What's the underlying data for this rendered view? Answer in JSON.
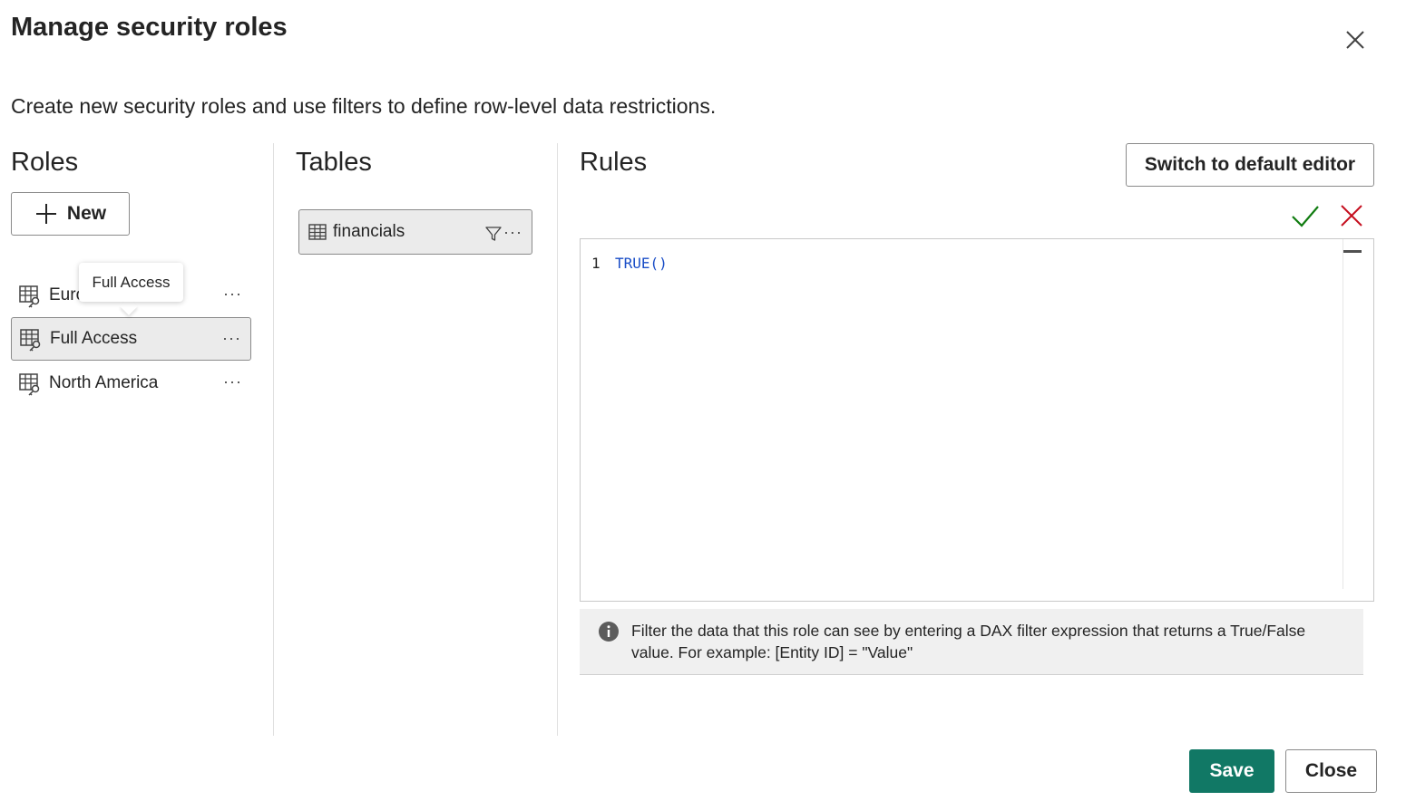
{
  "dialog": {
    "title": "Manage security roles",
    "subtitle": "Create new security roles and use filters to define row-level data restrictions.",
    "close_icon": "close-icon"
  },
  "roles": {
    "heading": "Roles",
    "new_button": "New",
    "tooltip": "Full Access",
    "items": [
      {
        "label": "Euro",
        "selected": false,
        "icon": "role-table-key-icon"
      },
      {
        "label": "Full Access",
        "selected": true,
        "icon": "role-table-key-icon"
      },
      {
        "label": "North America",
        "selected": false,
        "icon": "role-table-key-icon"
      }
    ],
    "more_label": "···"
  },
  "tables": {
    "heading": "Tables",
    "items": [
      {
        "label": "financials",
        "icon": "table-icon"
      }
    ],
    "more_label": "···"
  },
  "rules": {
    "heading": "Rules",
    "switch_button": "Switch to default editor",
    "editor": {
      "line_number": "1",
      "code": "TRUE()"
    },
    "info": "Filter the data that this role can see by entering a DAX filter expression that returns a True/False value. For example: [Entity ID] = \"Value\""
  },
  "footer": {
    "save": "Save",
    "close": "Close"
  },
  "colors": {
    "primary": "#117865",
    "accept": "#107c10",
    "reject": "#c50f1f",
    "code": "#1a4ec7"
  }
}
